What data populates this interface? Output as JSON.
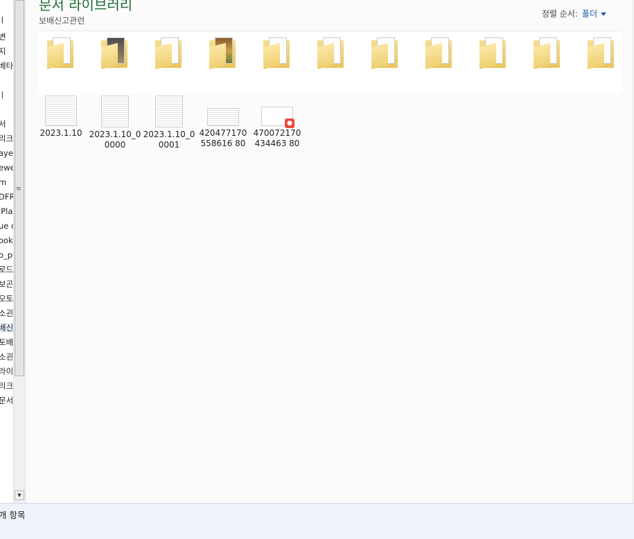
{
  "nav": {
    "items": [
      "ㅣ",
      "변",
      "지",
      "베타",
      "ㅣ",
      "서",
      "리크",
      "ayer",
      "ewe",
      "m",
      "DFRe",
      "lPla",
      "ue c",
      "ook",
      "o_pc",
      "로드",
      "보곤",
      "오토",
      "소괸",
      "배신",
      "토배",
      "소괸",
      "라이",
      "리크",
      "문서"
    ]
  },
  "library": {
    "title": "문서 라이브러리",
    "subtitle": "보배신고관련",
    "sort_label": "정렬 순서:",
    "sort_value": "폴더"
  },
  "folders": [
    {
      "preview": "document"
    },
    {
      "preview": "photos"
    },
    {
      "preview": "document"
    },
    {
      "preview": "food"
    },
    {
      "preview": "document"
    },
    {
      "preview": "document"
    },
    {
      "preview": "document"
    },
    {
      "preview": "document"
    },
    {
      "preview": "document"
    },
    {
      "preview": "document"
    },
    {
      "preview": "document"
    }
  ],
  "files": [
    {
      "name": "2023.1.10",
      "type": "image"
    },
    {
      "name": "2023.1.10_00000",
      "type": "document"
    },
    {
      "name": "2023.1.10_00001",
      "type": "document"
    },
    {
      "name": "420477170558616 80",
      "type": "image"
    },
    {
      "name": "470072170434463 80",
      "type": "video"
    }
  ],
  "status": {
    "text": "개 항목"
  }
}
